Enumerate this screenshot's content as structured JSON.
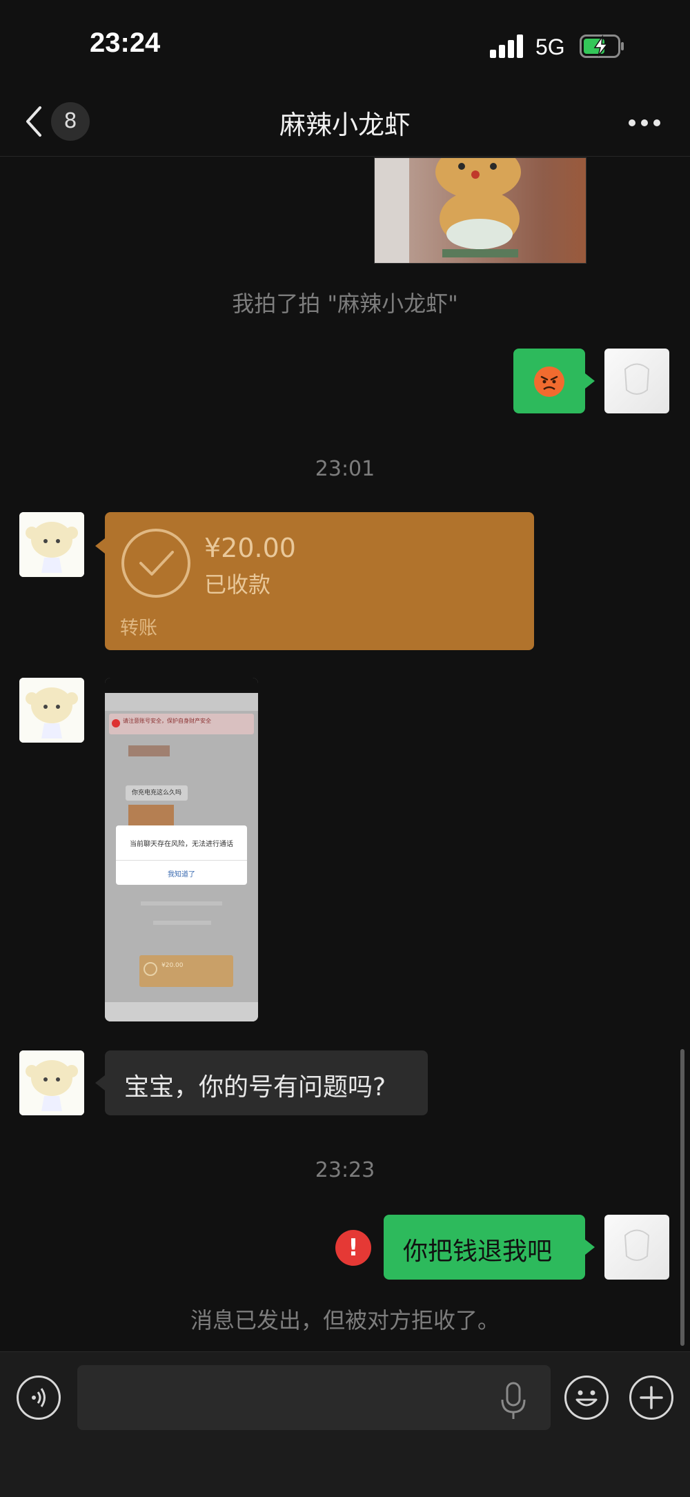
{
  "status_bar": {
    "time": "23:24",
    "network": "5G",
    "battery_charging": true
  },
  "nav": {
    "back_count": "8",
    "title": "麻辣小龙虾",
    "icons": [
      "chevron-left-icon",
      "more-icon"
    ]
  },
  "messages": {
    "pat_text": "我拍了拍 \"麻辣小龙虾\"",
    "sent_emoji": "😡",
    "time_1": "23:01",
    "transfer": {
      "amount": "¥20.00",
      "status": "已收款",
      "label": "转账"
    },
    "received_text": "宝宝，你的号有问题吗?",
    "time_2": "23:23",
    "sent_text": "你把钱退我吧",
    "failed_indicator": "!",
    "rejected_notice": "消息已发出，但被对方拒收了。"
  },
  "screenshot_preview": {
    "warning_text": "请注意账号安全，保护自身财产安全",
    "msg_text": "你充电充这么久吗",
    "dialog_text": "当前聊天存在风险，无法进行通话",
    "dialog_button": "我知道了",
    "mini_amount": "¥20.00"
  },
  "colors": {
    "background": "#111111",
    "sent_bubble": "#2dba5c",
    "received_bubble": "#2c2c2c",
    "transfer_card": "#b1732c",
    "error": "#e53935"
  },
  "input_bar": {
    "icons": [
      "voice-icon",
      "microphone-icon",
      "emoji-icon",
      "plus-icon"
    ]
  }
}
